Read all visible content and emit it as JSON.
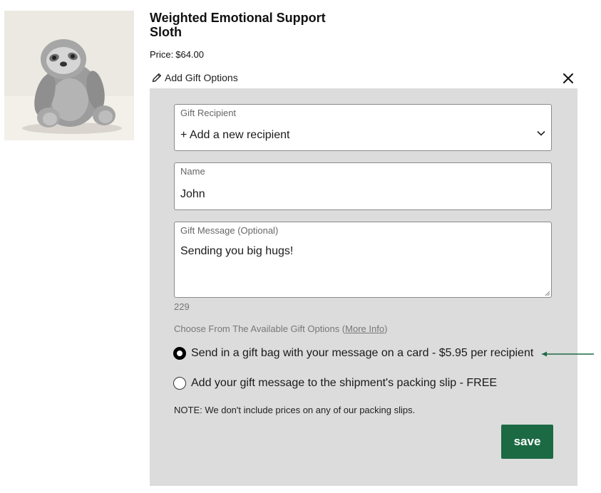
{
  "product": {
    "title": "Weighted Emotional Support Sloth",
    "price_label": "Price:",
    "price": "$64.00",
    "image_icon": "sloth-plush-image"
  },
  "gift_options": {
    "toggle_label": "Add Gift Options",
    "recipient": {
      "label": "Gift Recipient",
      "value": "+ Add a new recipient"
    },
    "name": {
      "label": "Name",
      "value": "John"
    },
    "message": {
      "label": "Gift Message (Optional)",
      "value": "Sending you big hugs!",
      "remaining_chars": "229"
    },
    "options_heading": "Choose From The Available Gift Options (",
    "more_info_link": "More Info",
    "options_heading_close": ")",
    "options": [
      {
        "label": "Send in a gift bag with your message on a card - $5.95 per recipient",
        "selected": true
      },
      {
        "label": "Add your gift message to the shipment's packing slip - FREE",
        "selected": false
      }
    ],
    "note": "NOTE: We don't include prices on any of our packing slips.",
    "save_label": "save"
  },
  "colors": {
    "panel_bg": "#dcdcdc",
    "save_button": "#1b6a44",
    "annotation_arrow": "#1b6a44"
  }
}
